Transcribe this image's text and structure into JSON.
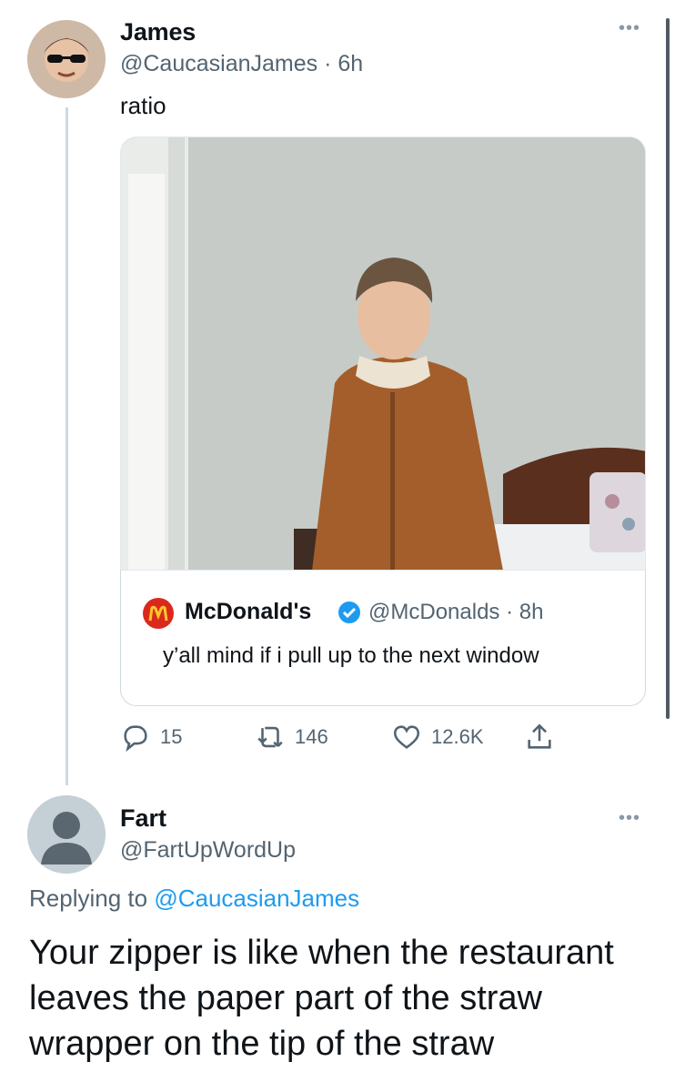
{
  "tweet": {
    "name": "James",
    "handle": "@CaucasianJames",
    "time": "6h",
    "text": "ratio",
    "quote": {
      "name": "McDonald's",
      "handle": "@McDonalds",
      "time": "8h",
      "text": "y’all mind if i pull up to the next window",
      "logo_color": "#da291c"
    },
    "stats": {
      "replies": "15",
      "retweets": "146",
      "likes": "12.6K"
    }
  },
  "reply": {
    "name": "Fart",
    "handle": "@FartUpWordUp",
    "replying_prefix": "Replying to",
    "replying_to": "@CaucasianJames",
    "text": "Your zipper is like when the restaurant leaves the paper part of the straw wrapper on the tip of the straw"
  },
  "colors": {
    "accent": "#1d9bf0",
    "muted": "#536471"
  }
}
